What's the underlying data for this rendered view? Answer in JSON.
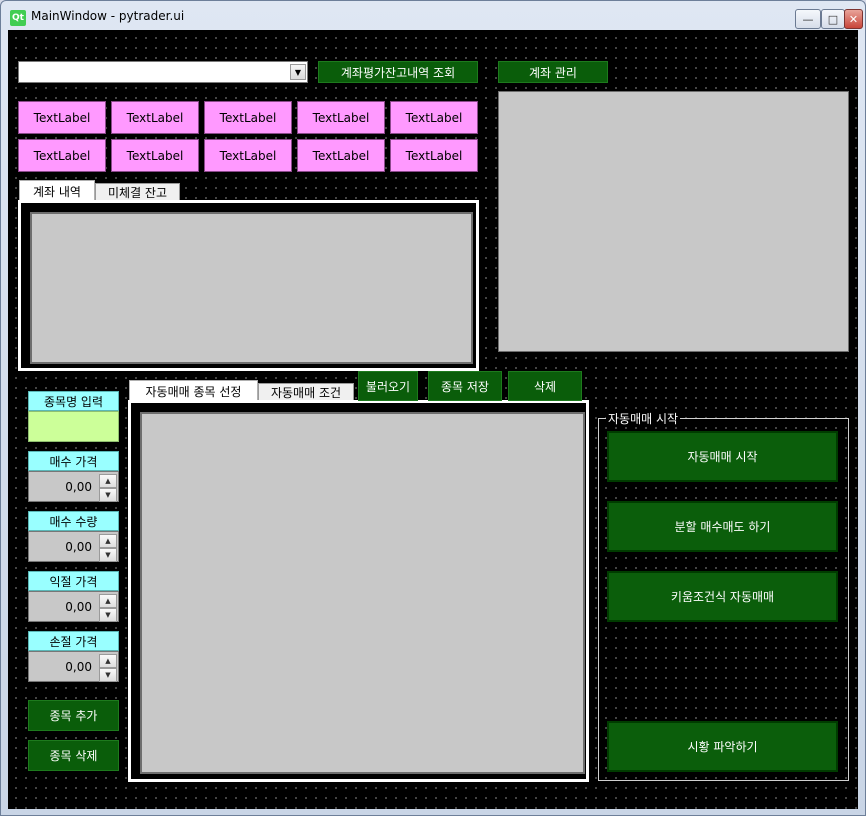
{
  "window": {
    "title": "MainWindow - pytrader.ui",
    "app_icon": "Qt",
    "caption_buttons": {
      "minimize": "minimize-icon",
      "maximize": "maximize-icon",
      "close": "close-icon"
    }
  },
  "top": {
    "account_combo_value": "",
    "query_button": "계좌평가잔고내역 조회",
    "account_manage_button": "계좌 관리"
  },
  "labels": {
    "row1": [
      "TextLabel",
      "TextLabel",
      "TextLabel",
      "TextLabel",
      "TextLabel"
    ],
    "row2": [
      "TextLabel",
      "TextLabel",
      "TextLabel",
      "TextLabel",
      "TextLabel"
    ]
  },
  "account_tabs": [
    "계좌 내역",
    "미체결 잔고"
  ],
  "auto_tabs": [
    "자동매매 종목 선정",
    "자동매매 조건"
  ],
  "auto_buttons": {
    "load": "불러오기",
    "save": "종목 저장",
    "delete": "삭제"
  },
  "form": {
    "stock_name_label": "종목명 입력",
    "stock_name_value": "",
    "buy_price_label": "매수 가격",
    "buy_price_value": "0,00",
    "buy_qty_label": "매수 수량",
    "buy_qty_value": "0,00",
    "take_profit_label": "익절 가격",
    "take_profit_value": "0,00",
    "stop_loss_label": "손절 가격",
    "stop_loss_value": "0,00",
    "add_button": "종목 추가",
    "remove_button": "종목 삭제"
  },
  "auto_group": {
    "title": "자동매매 시작",
    "start_button": "자동매매 시작",
    "split_button": "분할 매수매도 하기",
    "kiwoom_button": "키움조건식 자동매매",
    "market_button": "시황 파악하기"
  },
  "colors": {
    "button_green": "#0a5d0a",
    "label_pink": "#ff99ff",
    "label_cyan": "#99ffff",
    "input_lime": "#ccff99",
    "panel_gray": "#c8c8c8",
    "background": "#000000"
  }
}
